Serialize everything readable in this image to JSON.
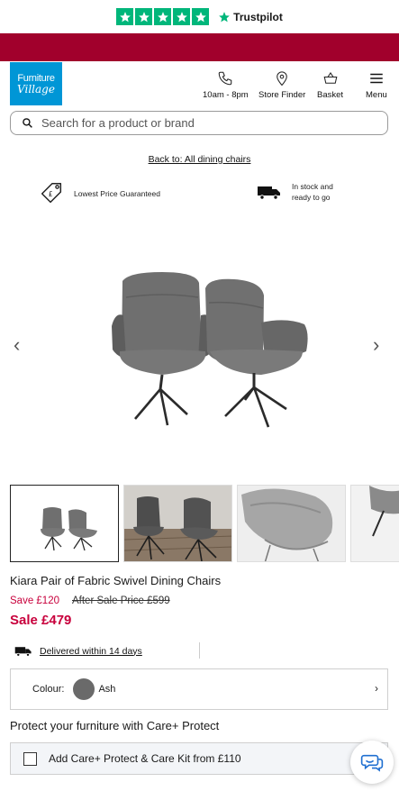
{
  "trustpilot": {
    "brand": "Trustpilot",
    "rating_stars": 5,
    "star_color": "#00b67a"
  },
  "promo_bar": {
    "color": "#a1002c"
  },
  "header": {
    "logo_line1": "Furniture",
    "logo_line2": "Village",
    "logo_color": "#0096d6",
    "nav": [
      {
        "label": "10am - 8pm",
        "icon": "phone-icon"
      },
      {
        "label": "Store Finder",
        "icon": "location-pin-icon"
      },
      {
        "label": "Basket",
        "icon": "basket-icon"
      },
      {
        "label": "Menu",
        "icon": "hamburger-menu-icon"
      }
    ]
  },
  "search": {
    "placeholder": "Search for a product or brand"
  },
  "breadcrumb": {
    "back_link": "Back to: All dining chairs"
  },
  "usps": [
    {
      "label": "Lowest Price Guaranteed",
      "icon": "price-tag-icon"
    },
    {
      "label_line1": "In stock and",
      "label_line2": "ready to go",
      "icon": "delivery-truck-icon"
    }
  ],
  "gallery": {
    "thumbnail_count": 4,
    "active_index": 0
  },
  "product": {
    "title": "Kiara Pair of Fabric Swivel Dining Chairs",
    "save": "Save £120",
    "was_price": "After Sale Price £599",
    "sale_price": "Sale £479",
    "price_color": "#c8003c"
  },
  "delivery": {
    "label": "Delivered within 14 days"
  },
  "colour": {
    "label": "Colour:",
    "value": "Ash",
    "swatch": "#6a6a6a"
  },
  "protection": {
    "heading": "Protect your furniture with Care+ Protect",
    "option": "Add Care+ Protect & Care Kit from £110",
    "checked": false
  }
}
